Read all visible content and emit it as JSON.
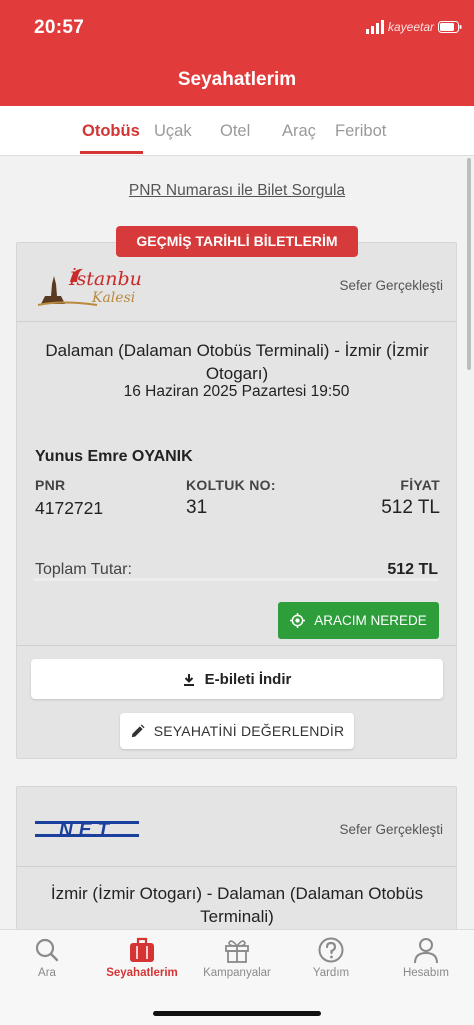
{
  "status_bar": {
    "time": "20:57",
    "carrier": "kayeetar"
  },
  "header": {
    "title": "Seyahatlerim"
  },
  "tabs": [
    {
      "label": "Otobüs",
      "active": true
    },
    {
      "label": "Uçak",
      "active": false
    },
    {
      "label": "Otel",
      "active": false
    },
    {
      "label": "Araç",
      "active": false
    },
    {
      "label": "Feribot",
      "active": false
    }
  ],
  "pnr_query_link": "PNR Numarası ile Bilet Sorgula",
  "past_tickets_badge": "GEÇMİŞ TARİHLİ BİLETLERİM",
  "tickets": [
    {
      "company_logo_text": "İstanbul",
      "company_logo_subtext": "Kalesi",
      "status": "Sefer Gerçekleşti",
      "route": "Dalaman (Dalaman Otobüs Terminali) - İzmir (İzmir Otogarı)",
      "date": "16 Haziran 2025 Pazartesi 19:50",
      "passenger_name": "Yunus Emre OYANIK",
      "pnr_label": "PNR",
      "pnr": "4172721",
      "seat_label": "KOLTUK NO:",
      "seat": "31",
      "price_label": "FİYAT",
      "price": "512 TL",
      "total_label": "Toplam Tutar:",
      "total": "512 TL",
      "where_is_my_bus": "ARACIM NEREDE",
      "download_eticket": "E-bileti İndir",
      "rate_trip": "SEYAHATİNİ DEĞERLENDİR"
    },
    {
      "company_logo_text": "NET",
      "status": "Sefer Gerçekleşti",
      "route": "İzmir (İzmir Otogarı) - Dalaman (Dalaman Otobüs Terminali)"
    }
  ],
  "bottom_nav": [
    {
      "label": "Ara",
      "icon": "search-icon",
      "active": false
    },
    {
      "label": "Seyahatlerim",
      "icon": "suitcase-icon",
      "active": true
    },
    {
      "label": "Kampanyalar",
      "icon": "gift-icon",
      "active": false
    },
    {
      "label": "Yardım",
      "icon": "help-icon",
      "active": false
    },
    {
      "label": "Hesabım",
      "icon": "profile-icon",
      "active": false
    }
  ],
  "colors": {
    "brand_red": "#e23b3b",
    "accent_red": "#d43434",
    "green": "#2e9e3b"
  }
}
